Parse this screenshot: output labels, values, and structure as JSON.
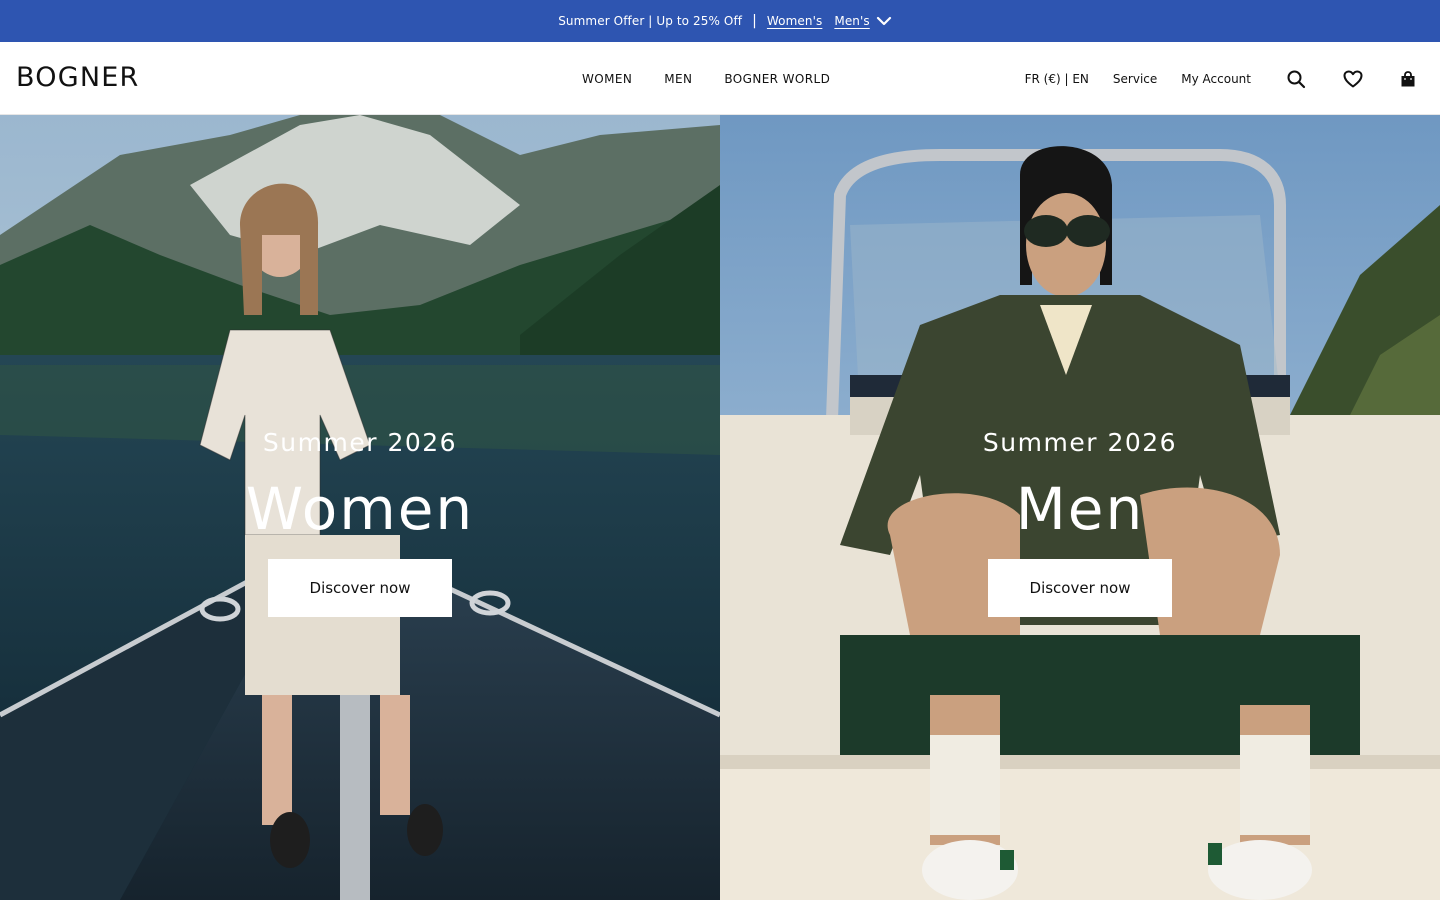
{
  "promo": {
    "text": "Summer Offer | Up to 25% Off",
    "separator": "|",
    "links": [
      "Women's",
      "Men's"
    ],
    "background": "#2e55b1"
  },
  "header": {
    "logo": "BOGNER",
    "nav": [
      "WOMEN",
      "MEN",
      "BOGNER WORLD"
    ],
    "locale": "FR (€) | EN",
    "service": "Service",
    "account": "My Account",
    "icons": [
      "search-icon",
      "heart-icon",
      "bag-icon"
    ]
  },
  "hero": [
    {
      "subtitle": "Summer 2026",
      "title": "Women",
      "cta": "Discover now"
    },
    {
      "subtitle": "Summer 2026",
      "title": "Men",
      "cta": "Discover now"
    }
  ]
}
